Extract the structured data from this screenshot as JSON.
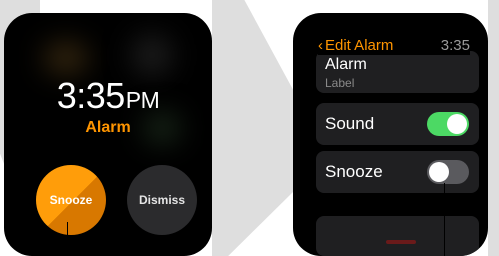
{
  "alert_screen": {
    "time": "3:35",
    "ampm": "PM",
    "label": "Alarm",
    "snooze_label": "Snooze",
    "dismiss_label": "Dismiss"
  },
  "edit_screen": {
    "back_label": "Edit Alarm",
    "clock": "3:35",
    "label_row": {
      "title": "Alarm",
      "subtitle": "Label"
    },
    "sound_row": {
      "label": "Sound",
      "enabled": true
    },
    "snooze_row": {
      "label": "Snooze",
      "enabled": false
    }
  },
  "colors": {
    "accent": "#ff9500",
    "toggle_on": "#4cd964",
    "toggle_off": "#5a5a5e"
  }
}
